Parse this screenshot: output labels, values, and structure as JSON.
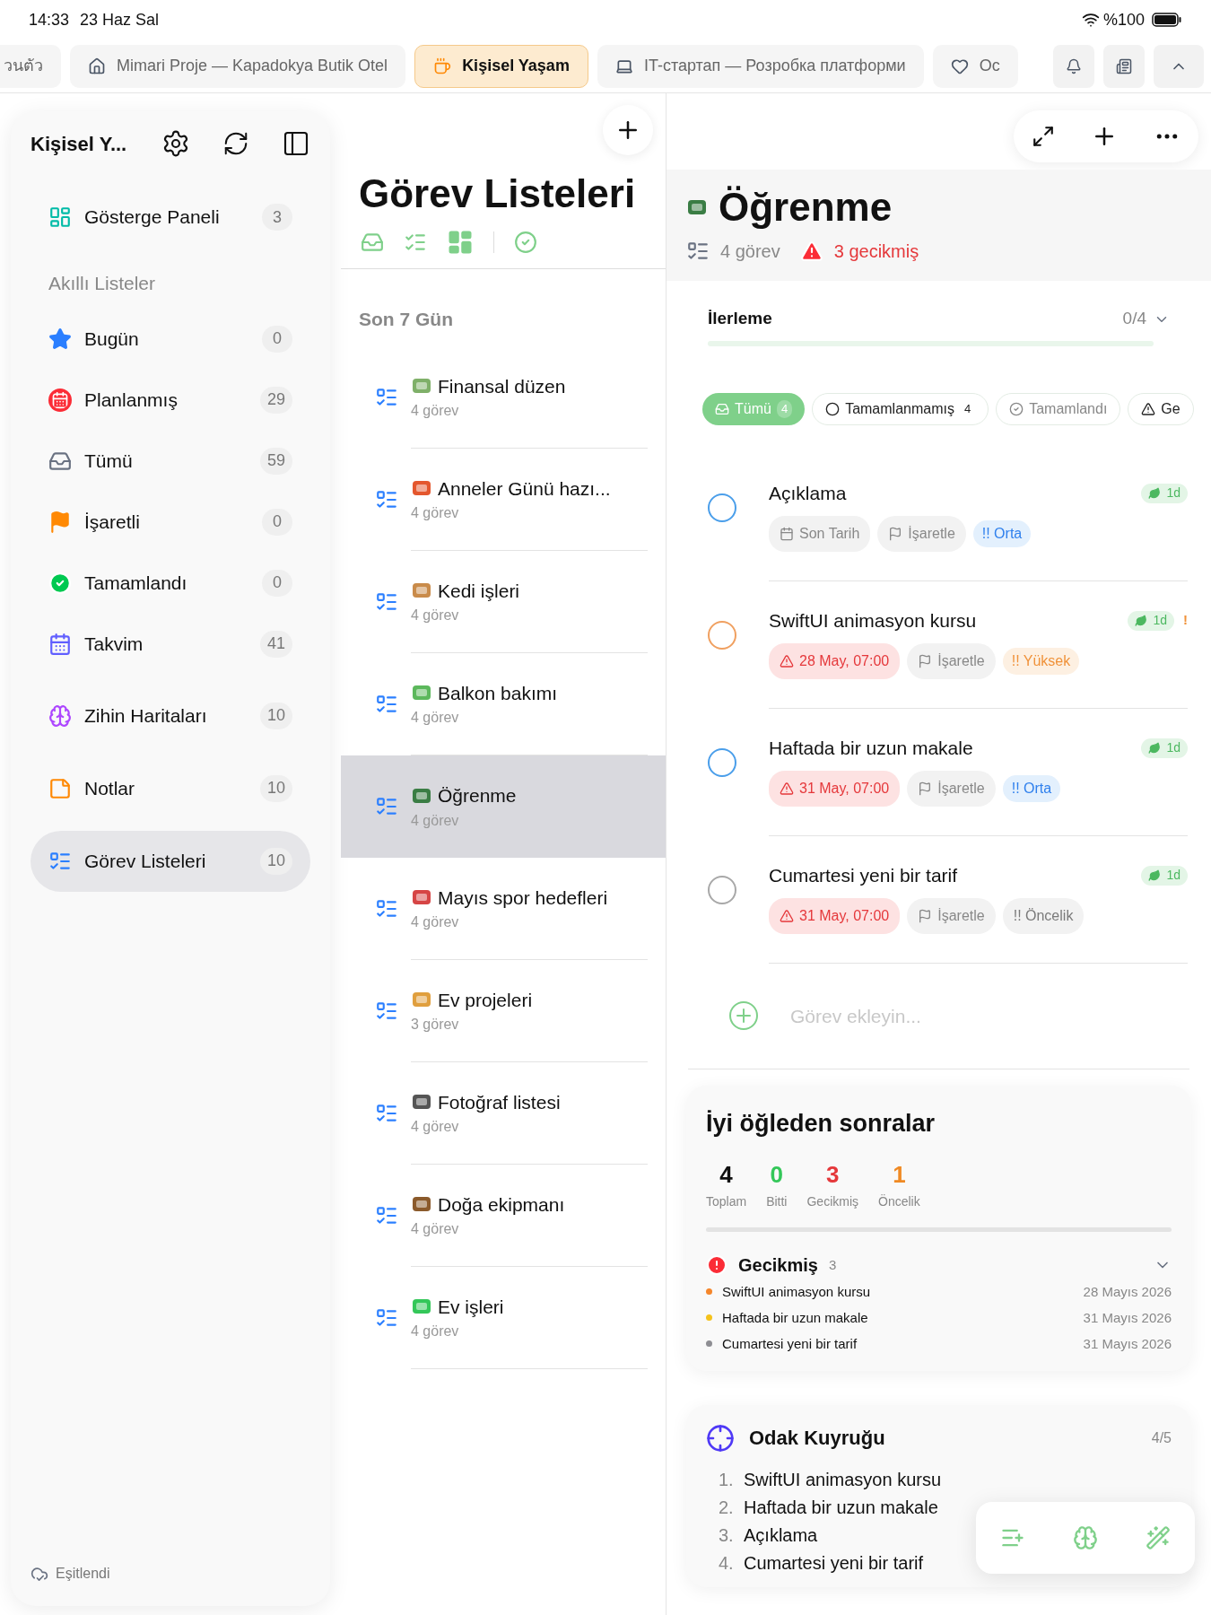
{
  "status_bar": {
    "time": "14:33",
    "date": "23 Haz Sal",
    "battery": "%100"
  },
  "tabs": [
    {
      "label": "วนตัว",
      "kind": "none",
      "selected": false
    },
    {
      "label": "Mimari Proje — Kapadokya Butik Otel",
      "kind": "house",
      "selected": false
    },
    {
      "label": "Kişisel Yaşam",
      "kind": "cup",
      "selected": true
    },
    {
      "label": "IT-стартап — Розробка платформи",
      "kind": "laptop",
      "selected": false
    },
    {
      "label": "Oc",
      "kind": "heart",
      "selected": false
    }
  ],
  "sidebar": {
    "title": "Kişisel Y...",
    "sync_status": "Eşitlendi",
    "section_header": "Akıllı Listeler",
    "items": [
      {
        "label": "Gösterge Paneli",
        "count": "3",
        "kind": "dashboard",
        "selected": false
      },
      {
        "label": "Bugün",
        "count": "0",
        "kind": "star",
        "selected": false
      },
      {
        "label": "Planlanmış",
        "count": "29",
        "kind": "calendar-red",
        "selected": false
      },
      {
        "label": "Tümü",
        "count": "59",
        "kind": "tray",
        "selected": false
      },
      {
        "label": "İşaretli",
        "count": "0",
        "kind": "flag",
        "selected": false
      },
      {
        "label": "Tamamlandı",
        "count": "0",
        "kind": "check",
        "selected": false
      },
      {
        "label": "Takvim",
        "count": "41",
        "kind": "calendar",
        "selected": false
      },
      {
        "label": "Zihin Haritaları",
        "count": "10",
        "kind": "brain",
        "selected": false
      },
      {
        "label": "Notlar",
        "count": "10",
        "kind": "notes",
        "selected": false
      },
      {
        "label": "Görev Listeleri",
        "count": "10",
        "kind": "list",
        "selected": true
      }
    ]
  },
  "lists": {
    "title": "Görev Listeleri",
    "section": "Son 7 Gün",
    "items": [
      {
        "name": "Finansal düzen",
        "count": "4 görev",
        "kind": "money",
        "selected": false
      },
      {
        "name": "Anneler Günü hazı...",
        "count": "4 görev",
        "kind": "gift",
        "selected": false
      },
      {
        "name": "Kedi işleri",
        "count": "4 görev",
        "kind": "cat",
        "selected": false
      },
      {
        "name": "Balkon bakımı",
        "count": "4 görev",
        "kind": "sprout",
        "selected": false
      },
      {
        "name": "Öğrenme",
        "count": "4 görev",
        "kind": "books",
        "selected": true
      },
      {
        "name": "Mayıs spor hedefleri",
        "count": "4 görev",
        "kind": "target",
        "selected": false
      },
      {
        "name": "Ev projeleri",
        "count": "3 görev",
        "kind": "home",
        "selected": false
      },
      {
        "name": "Fotoğraf listesi",
        "count": "4 görev",
        "kind": "camera",
        "selected": false
      },
      {
        "name": "Doğa ekipmanı",
        "count": "4 görev",
        "kind": "boot",
        "selected": false
      },
      {
        "name": "Ev işleri",
        "count": "4 görev",
        "kind": "checkbox",
        "selected": false
      }
    ]
  },
  "detail": {
    "title": "Öğrenme",
    "task_count": "4 görev",
    "overdue": "3 gecikmiş",
    "progress": {
      "label": "İlerleme",
      "reading": "0/4",
      "level": 0
    },
    "filters": [
      {
        "label": "Tümü",
        "count": "4",
        "kind": "tray",
        "selected": true
      },
      {
        "label": "Tamamlanmamış",
        "count": "4",
        "kind": "circle",
        "selected": false
      },
      {
        "label": "Tamamlandı",
        "kind": "check",
        "selected": false
      },
      {
        "label": "Ge",
        "kind": "warning",
        "selected": false
      }
    ],
    "tasks": [
      {
        "title": "Açıklama",
        "color": "#4a9eea",
        "checked": false,
        "date": "Son Tarih",
        "overdue": false,
        "flag": "İşaretle",
        "priority": "!! Orta",
        "kind": "medium",
        "tag": "1d"
      },
      {
        "title": "SwiftUI animasyon kursu",
        "color": "#f0a060",
        "checked": false,
        "date": "28 May, 07:00",
        "overdue": true,
        "flag": "İşaretle",
        "priority": "!! Yüksek",
        "kind": "high",
        "tag": "1d",
        "alert": "!"
      },
      {
        "title": "Haftada bir uzun makale",
        "color": "#4a9eea",
        "checked": false,
        "date": "31 May, 07:00",
        "overdue": true,
        "flag": "İşaretle",
        "priority": "!! Orta",
        "kind": "medium",
        "tag": "1d"
      },
      {
        "title": "Cumartesi yeni bir tarif",
        "color": "#a8a8a8",
        "checked": false,
        "date": "31 May, 07:00",
        "overdue": true,
        "flag": "İşaretle",
        "priority": "!! Öncelik",
        "kind": "none",
        "tag": "1d"
      }
    ],
    "add_task_placeholder": "Görev ekleyin...",
    "summary": {
      "greeting": "İyi öğleden sonralar",
      "stats": [
        {
          "value": "4",
          "label": "Toplam",
          "color": "#111111"
        },
        {
          "value": "0",
          "label": "Bitti",
          "color": "#34c759"
        },
        {
          "value": "3",
          "label": "Gecikmiş",
          "color": "#e5383b"
        },
        {
          "value": "1",
          "label": "Öncelik",
          "color": "#f08a24"
        }
      ],
      "overdue_title": "Gecikmiş",
      "overdue_count": "3",
      "overdue_items": [
        {
          "title": "SwiftUI animasyon kursu",
          "date": "28 Mayıs 2026",
          "color": "#f5862b"
        },
        {
          "title": "Haftada bir uzun makale",
          "date": "31 Mayıs 2026",
          "color": "#f5c21b"
        },
        {
          "title": "Cumartesi yeni bir tarif",
          "date": "31 Mayıs 2026",
          "color": "#8e8e93"
        }
      ]
    },
    "focus": {
      "title": "Odak Kuyruğu",
      "reading": "4/5",
      "items": [
        {
          "number": "1.",
          "title": "SwiftUI animasyon kursu"
        },
        {
          "number": "2.",
          "title": "Haftada bir uzun makale"
        },
        {
          "number": "3.",
          "title": "Açıklama"
        },
        {
          "number": "4.",
          "title": "Cumartesi yeni bir tarif"
        }
      ]
    }
  }
}
